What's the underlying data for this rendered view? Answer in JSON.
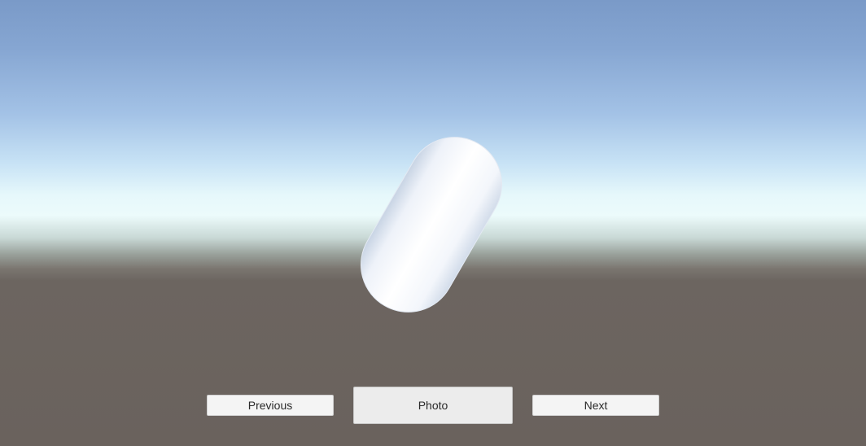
{
  "scene": {
    "object": "capsule"
  },
  "buttons": {
    "previous_label": "Previous",
    "photo_label": "Photo",
    "next_label": "Next"
  },
  "colors": {
    "sky_top": "#7a9ac8",
    "horizon": "#ecfbfb",
    "ground": "#6a625d",
    "button_bg": "#f4f4f4",
    "capsule": "#ffffff"
  }
}
